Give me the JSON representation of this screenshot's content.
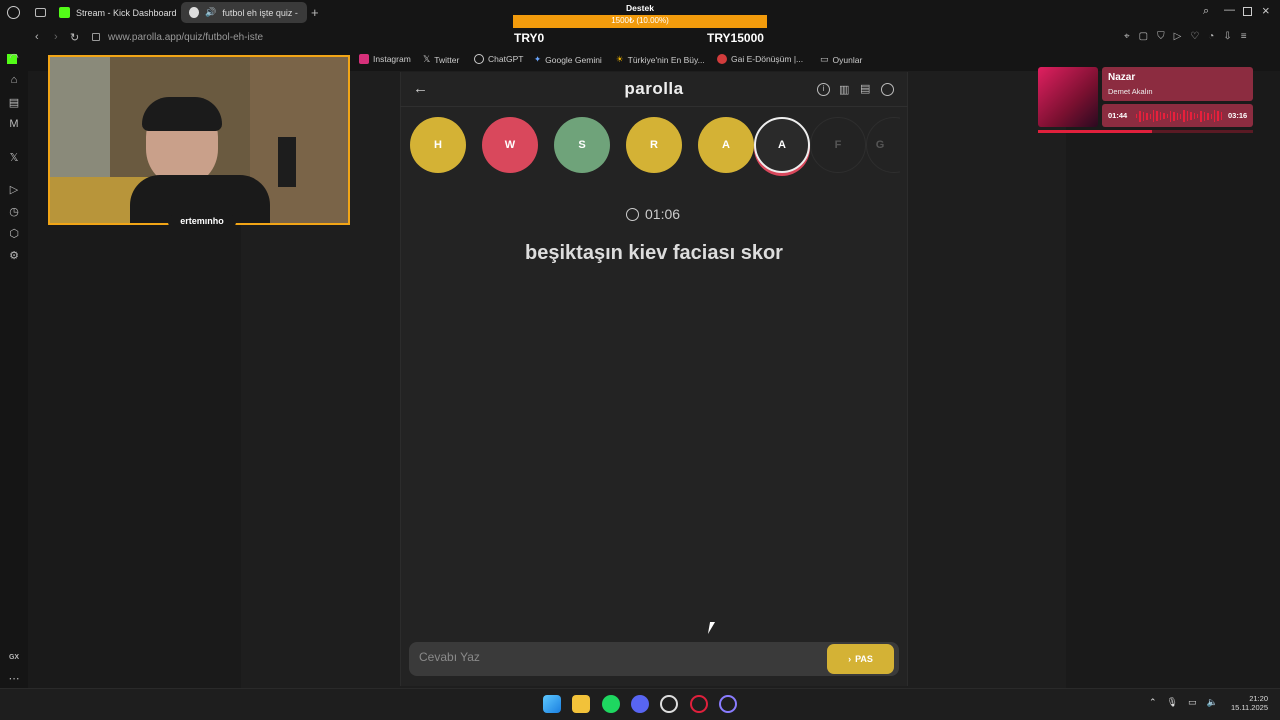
{
  "tabs": [
    {
      "label": "Stream - Kick Dashboard",
      "active": false
    },
    {
      "label": "futbol eh işte quiz - p",
      "active": true
    }
  ],
  "address": {
    "url": "www.parolla.app/quiz/futbol-eh-iste"
  },
  "bookmarks": [
    "Instagram",
    "Twitter",
    "ChatGPT",
    "Google Gemini",
    "Türkiye'nin En Büy...",
    "Gai E-Dönüşüm |...",
    "Oyunlar"
  ],
  "donation_goal": {
    "title": "Destek",
    "progress_text": "1500₺ (10.00%)",
    "progress": 0.1,
    "min": "TRY0",
    "max": "TRY15000",
    "color": "#f29b0c"
  },
  "webcam": {
    "name": "ertemınho"
  },
  "game": {
    "logo": "parolla",
    "letters": [
      {
        "letter": "H",
        "state": "yellow"
      },
      {
        "letter": "W",
        "state": "red"
      },
      {
        "letter": "S",
        "state": "green"
      },
      {
        "letter": "R",
        "state": "yellow"
      },
      {
        "letter": "A",
        "state": "yellow"
      },
      {
        "letter": "A",
        "state": "current"
      },
      {
        "letter": "F",
        "state": "pending"
      },
      {
        "letter": "G",
        "state": "pending"
      }
    ],
    "timer": "01:06",
    "question": "beşiktaşın kiev faciası skor",
    "answer_placeholder": "Cevabı Yaz",
    "pass_label": "PAS",
    "colors": {
      "yellow": "#d4b235",
      "red": "#d9485c",
      "green": "#6fa37a",
      "current": "#2a2a2a"
    }
  },
  "music": {
    "title": "Nazar",
    "artist": "Demet Akalın",
    "current": "01:44",
    "total": "03:16",
    "progress": 0.53
  },
  "clock": {
    "time": "21:20",
    "date": "15.11.2025"
  }
}
